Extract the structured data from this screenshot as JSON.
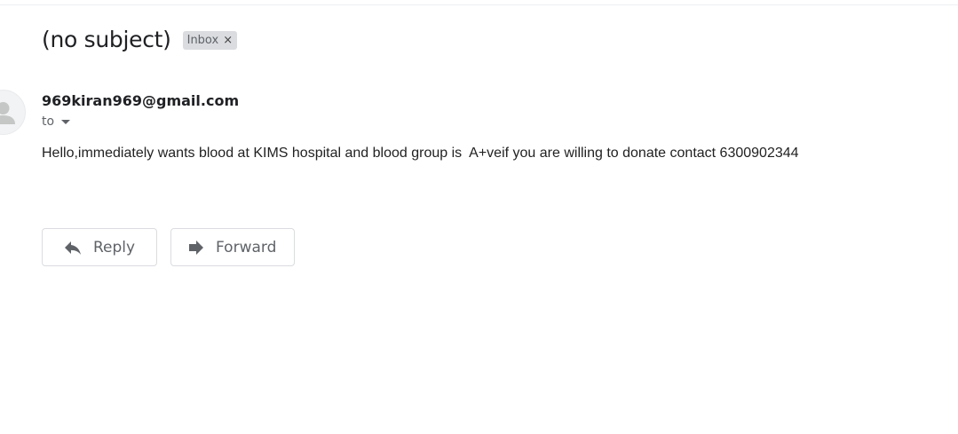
{
  "message": {
    "subject": "(no subject)",
    "label": "Inbox",
    "label_remove": "×",
    "sender": "969kiran969@gmail.com",
    "to_label": "to",
    "body": "Hello,immediately wants blood at KIMS hospital and blood group is  A+veif you are willing to donate contact 6300902344"
  },
  "actions": {
    "reply_label": "Reply",
    "forward_label": "Forward"
  },
  "icons": {
    "avatar": "person-icon",
    "reply": "reply-arrow-icon",
    "forward": "forward-arrow-icon",
    "to_dropdown": "caret-down-icon"
  },
  "colors": {
    "text": "#202124",
    "secondary": "#5f6368",
    "chip_bg": "#dadce0",
    "button_border": "#dadce0"
  }
}
